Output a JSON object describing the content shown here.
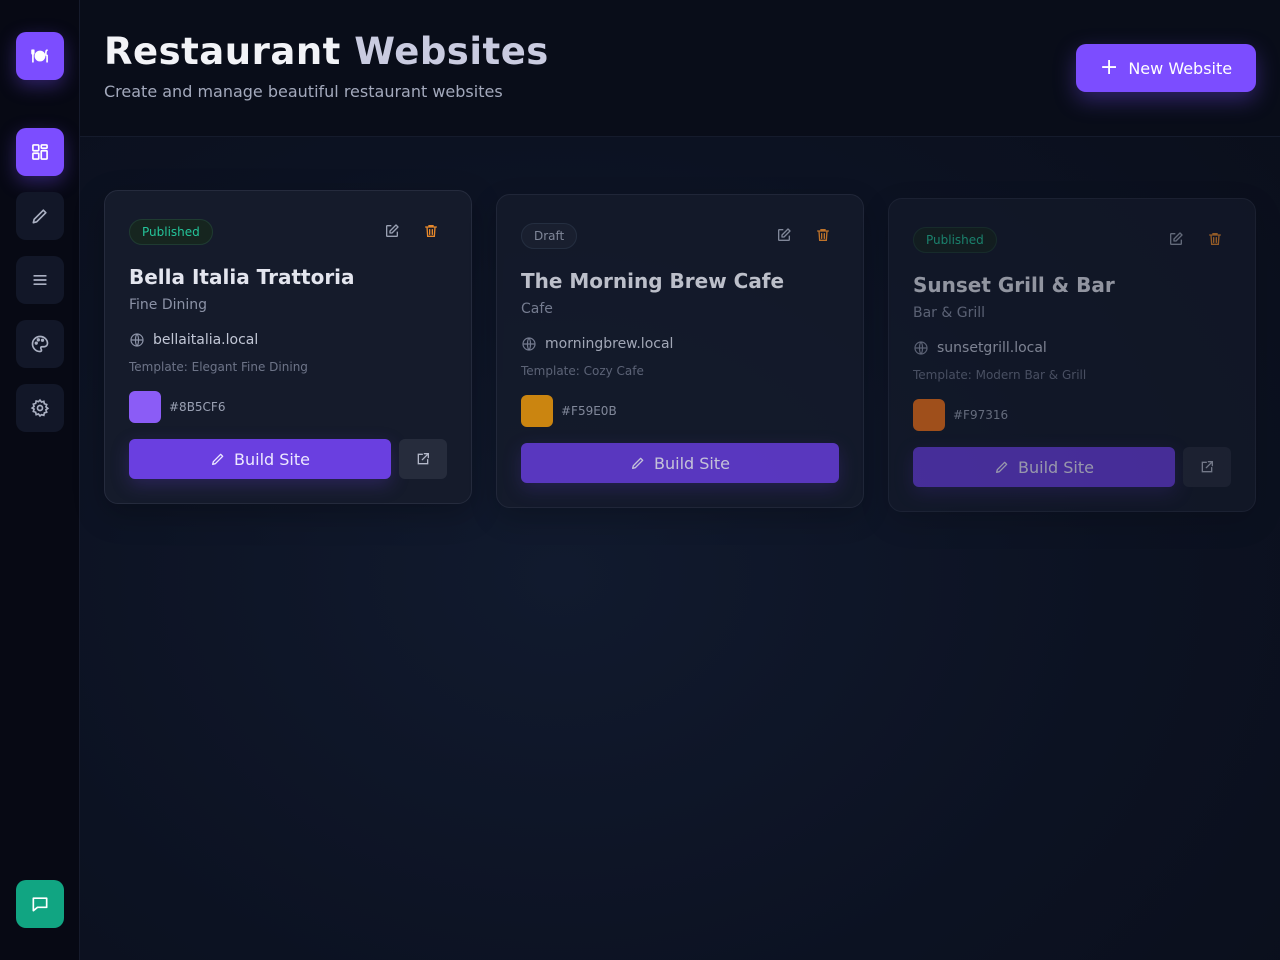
{
  "header": {
    "title_part1": "Restaurant ",
    "title_part2": "Websites",
    "subtitle": "Create and manage beautiful restaurant websites",
    "new_button_label": "New Website"
  },
  "sidebar": {
    "logo_icon": "restaurant-plate-icon",
    "items": [
      {
        "icon": "dashboard-icon",
        "active": true
      },
      {
        "icon": "pencil-icon",
        "active": false
      },
      {
        "icon": "menu-list-icon",
        "active": false
      },
      {
        "icon": "palette-icon",
        "active": false
      },
      {
        "icon": "settings-gear-icon",
        "active": false
      }
    ],
    "chat_icon": "chat-icon"
  },
  "colors": {
    "accent": "#7C4DFF",
    "published": "#24C49A",
    "delete": "#E7892C",
    "chat": "#11A582"
  },
  "cards": [
    {
      "status": "Published",
      "name": "Bella Italia Trattoria",
      "category": "Fine Dining",
      "domain": "bellaitalia.local",
      "template": "Template: Elegant Fine Dining",
      "color": "#8B5CF6",
      "build_label": "Build Site"
    },
    {
      "status": "Draft",
      "name": "The Morning Brew Cafe",
      "category": "Cafe",
      "domain": "morningbrew.local",
      "template": "Template: Cozy Cafe",
      "color": "#F59E0B",
      "build_label": "Build Site"
    },
    {
      "status": "Published",
      "name": "Sunset Grill & Bar",
      "category": "Bar & Grill",
      "domain": "sunsetgrill.local",
      "template": "Template: Modern Bar & Grill",
      "color": "#F97316",
      "build_label": "Build Site"
    }
  ]
}
